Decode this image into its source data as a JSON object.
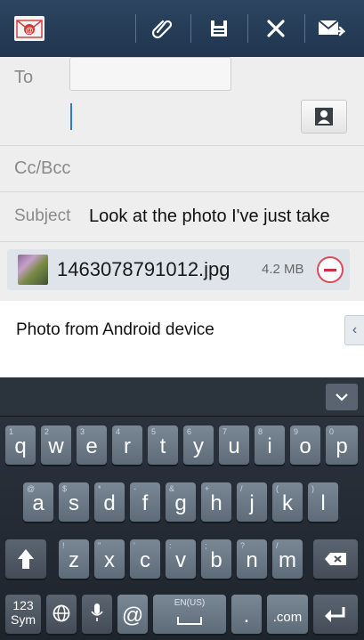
{
  "action_bar": {
    "app_icon": "email-app-icon",
    "actions": [
      {
        "name": "attach-icon"
      },
      {
        "name": "save-icon"
      },
      {
        "name": "discard-icon"
      },
      {
        "name": "send-icon"
      }
    ]
  },
  "compose": {
    "to_label": "To",
    "to_value": "",
    "cc_bcc_label": "Cc/Bcc",
    "subject_label": "Subject",
    "subject_value": "Look at the photo I've just take",
    "attachment": {
      "file_name": "1463078791012.jpg",
      "file_size": "4.2 MB"
    },
    "body_text": "Photo from Android device",
    "body_tab_glyph": "‹"
  },
  "keyboard": {
    "row1": [
      {
        "main": "q",
        "alt": "1"
      },
      {
        "main": "w",
        "alt": "2"
      },
      {
        "main": "e",
        "alt": "3"
      },
      {
        "main": "r",
        "alt": "4"
      },
      {
        "main": "t",
        "alt": "5"
      },
      {
        "main": "y",
        "alt": "6"
      },
      {
        "main": "u",
        "alt": "7"
      },
      {
        "main": "i",
        "alt": "8"
      },
      {
        "main": "o",
        "alt": "9"
      },
      {
        "main": "p",
        "alt": "0"
      }
    ],
    "row2": [
      {
        "main": "a",
        "alt": "@"
      },
      {
        "main": "s",
        "alt": "$"
      },
      {
        "main": "d",
        "alt": "*"
      },
      {
        "main": "f",
        "alt": "-"
      },
      {
        "main": "g",
        "alt": "&"
      },
      {
        "main": "h",
        "alt": "+"
      },
      {
        "main": "j",
        "alt": "/"
      },
      {
        "main": "k",
        "alt": "("
      },
      {
        "main": "l",
        "alt": ")"
      }
    ],
    "row3": [
      {
        "main": "z",
        "alt": "!"
      },
      {
        "main": "x",
        "alt": "\""
      },
      {
        "main": "c",
        "alt": "'"
      },
      {
        "main": "v",
        "alt": ":"
      },
      {
        "main": "b",
        "alt": ";"
      },
      {
        "main": "n",
        "alt": "?"
      },
      {
        "main": "m",
        "alt": "/"
      }
    ],
    "sym_label_1": "123",
    "sym_label_2": "Sym",
    "space_label": "EN(US)",
    "period_label": ".",
    "com_label": ".com",
    "at_label": "@"
  }
}
